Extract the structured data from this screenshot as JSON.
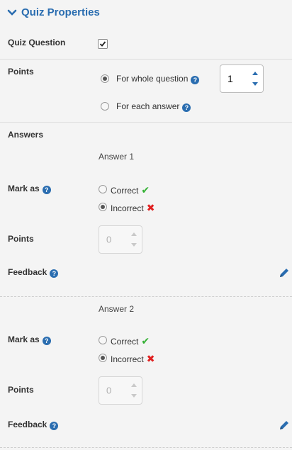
{
  "header": {
    "title": "Quiz Properties",
    "icon": "chevron-down-icon"
  },
  "quiz_question": {
    "label": "Quiz Question",
    "checked": true
  },
  "points": {
    "label": "Points",
    "options": [
      "For whole question",
      "For each answer"
    ],
    "selected": "For whole question",
    "value": "1"
  },
  "answers": {
    "label": "Answers",
    "items": [
      {
        "title": "Answer 1",
        "mark_label": "Mark as",
        "correct_label": "Correct",
        "incorrect_label": "Incorrect",
        "selected": "Incorrect",
        "points_label": "Points",
        "points_value": "0",
        "feedback_label": "Feedback"
      },
      {
        "title": "Answer 2",
        "mark_label": "Mark as",
        "correct_label": "Correct",
        "incorrect_label": "Incorrect",
        "selected": "Incorrect",
        "points_label": "Points",
        "points_value": "0",
        "feedback_label": "Feedback"
      }
    ]
  },
  "colors": {
    "accent": "#2a6db0",
    "correct": "#33b033",
    "incorrect": "#e02020"
  }
}
